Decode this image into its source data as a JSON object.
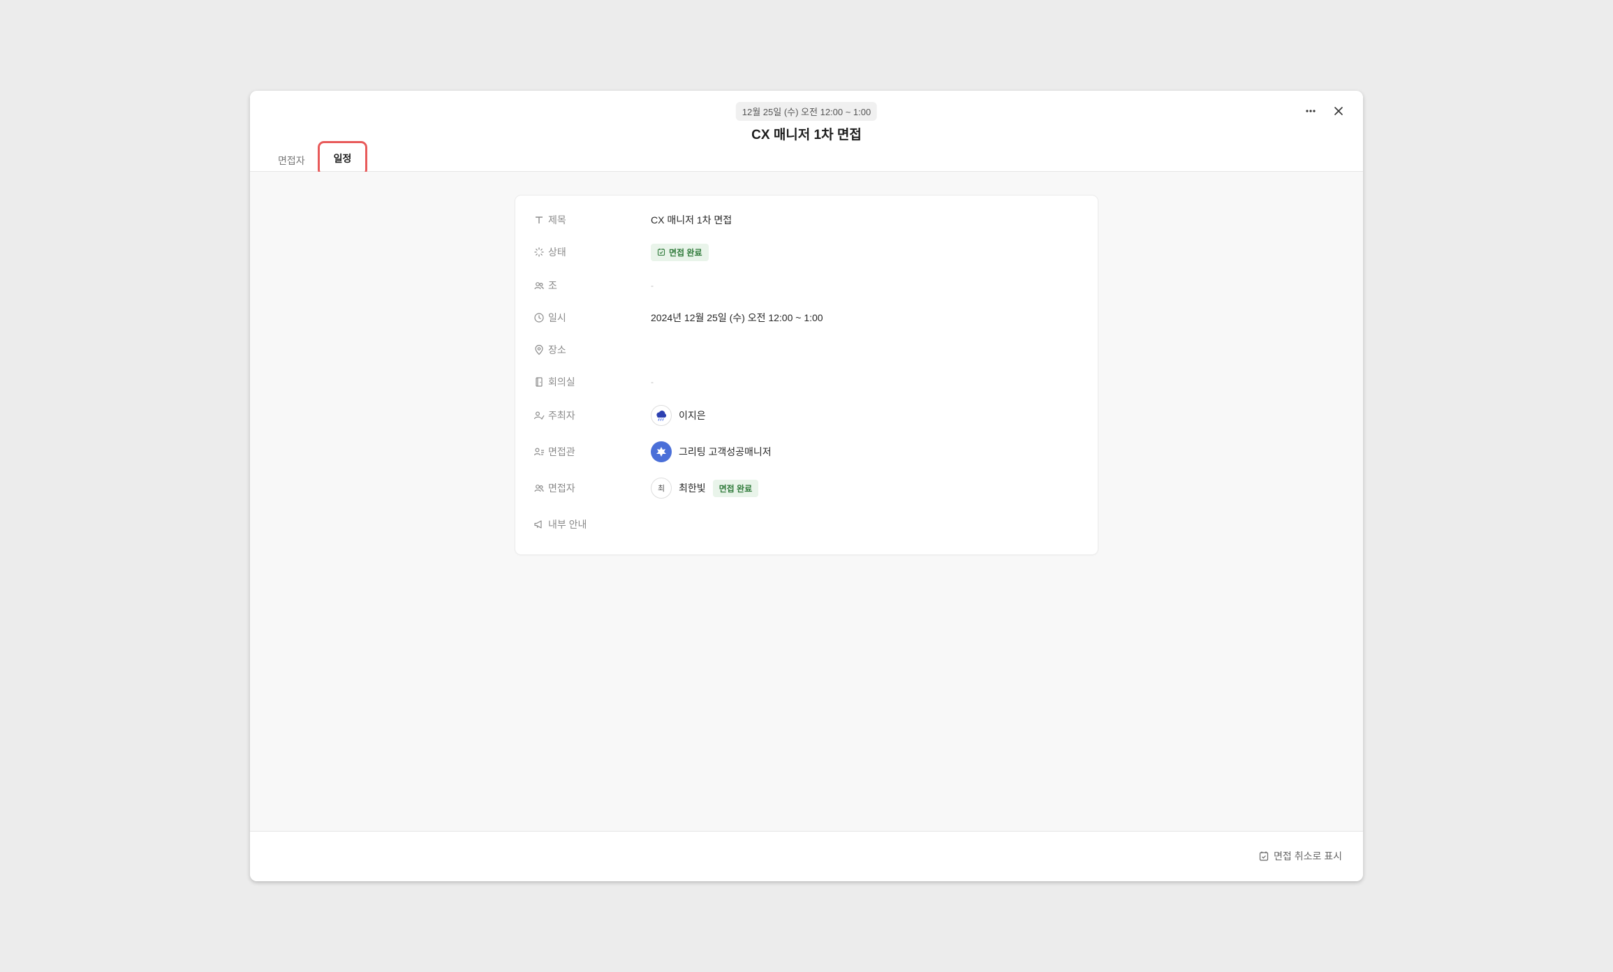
{
  "header": {
    "date_chip": "12월 25일 (수) 오전 12:00 ~ 1:00",
    "title": "CX 매니저 1차 면접",
    "more_icon": "more-horizontal-icon",
    "close_icon": "close-icon"
  },
  "tabs": [
    {
      "label": "면접자",
      "active": false
    },
    {
      "label": "일정",
      "active": true
    }
  ],
  "properties": {
    "title": {
      "label": "제목",
      "value": "CX 매니저 1차 면접",
      "icon": "text-icon"
    },
    "status": {
      "label": "상태",
      "value": "면접 완료",
      "icon": "status-icon",
      "badge_color": "#2f7a3a",
      "badge_bg": "#e9f4ea"
    },
    "group": {
      "label": "조",
      "value": "-",
      "icon": "group-icon"
    },
    "datetime": {
      "label": "일시",
      "value": "2024년 12월 25일 (수) 오전 12:00 ~ 1:00",
      "icon": "clock-icon"
    },
    "location": {
      "label": "장소",
      "value": "",
      "icon": "map-pin-icon"
    },
    "meeting_room": {
      "label": "회의실",
      "value": "-",
      "icon": "door-icon"
    },
    "organizer": {
      "label": "주최자",
      "name": "이지은",
      "icon": "organizer-icon"
    },
    "interviewer": {
      "label": "면접관",
      "name": "그리팅 고객성공매니저",
      "icon": "interviewer-icon"
    },
    "candidate": {
      "label": "면접자",
      "name": "최한빛",
      "initial": "최",
      "status": "면접 완료",
      "icon": "people-icon"
    },
    "internal_note": {
      "label": "내부 안내",
      "value": "",
      "icon": "megaphone-icon"
    }
  },
  "footer": {
    "cancel_label": "면접 취소로 표시",
    "icon": "calendar-check-icon"
  },
  "colors": {
    "highlight": "#e85a5a",
    "accent_blue": "#4a6fd8"
  }
}
